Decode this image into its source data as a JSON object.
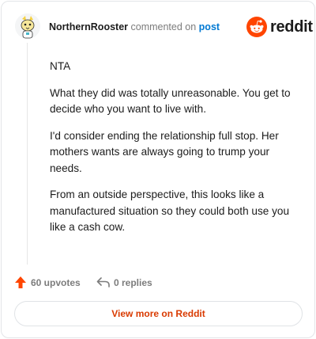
{
  "header": {
    "author": "NorthernRooster",
    "action": "commented on",
    "link_text": "post",
    "brand": "reddit",
    "brand_color": "#ff4500"
  },
  "comment": {
    "paragraphs": [
      "NTA",
      "What they did was totally unreasonable. You get to decide who you want to live with.",
      "I'd consider ending the relationship full stop. Her mothers wants are always going to trump your needs.",
      "From an outside perspective, this looks like a manufactured situation so they could both use you like a cash cow."
    ]
  },
  "stats": {
    "upvotes": "60 upvotes",
    "replies": "0 replies",
    "upvote_icon": "upvote-arrow-icon",
    "reply_icon": "reply-arrow-icon"
  },
  "footer": {
    "view_more_label": "View more on Reddit",
    "accent_color": "#d93a00"
  }
}
